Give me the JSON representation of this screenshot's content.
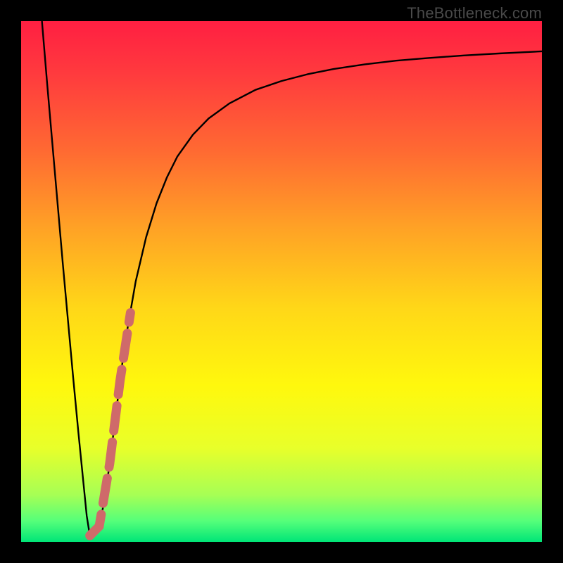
{
  "watermark": {
    "text": "TheBottleneck.com"
  },
  "chart_data": {
    "type": "line",
    "title": "",
    "xlabel": "",
    "ylabel": "",
    "xlim": [
      0,
      100
    ],
    "ylim": [
      0,
      100
    ],
    "grid": false,
    "legend": false,
    "gradient": {
      "stops": [
        {
          "offset": 0.0,
          "color": "#ff1f42"
        },
        {
          "offset": 0.1,
          "color": "#ff3a3e"
        },
        {
          "offset": 0.25,
          "color": "#ff6a32"
        },
        {
          "offset": 0.4,
          "color": "#ffa325"
        },
        {
          "offset": 0.55,
          "color": "#ffd718"
        },
        {
          "offset": 0.7,
          "color": "#fff80d"
        },
        {
          "offset": 0.82,
          "color": "#e8ff2a"
        },
        {
          "offset": 0.91,
          "color": "#a6ff55"
        },
        {
          "offset": 0.96,
          "color": "#55ff7a"
        },
        {
          "offset": 1.0,
          "color": "#00e577"
        }
      ]
    },
    "series": [
      {
        "name": "bottleneck-curve",
        "stroke": "#000000",
        "stroke_width": 2.4,
        "x": [
          4.0,
          5.0,
          6.0,
          7.0,
          8.0,
          9.0,
          10.0,
          11.0,
          12.0,
          12.6,
          13.2,
          14.0,
          15.0,
          16.0,
          17.0,
          18.0,
          19.0,
          20.0,
          22.0,
          24.0,
          26.0,
          28.0,
          30.0,
          33.0,
          36.0,
          40.0,
          45.0,
          50.0,
          55.0,
          60.0,
          66.0,
          72.0,
          78.0,
          85.0,
          92.0,
          100.0
        ],
        "y": [
          100.0,
          88.0,
          76.5,
          65.0,
          53.5,
          42.5,
          31.5,
          21.0,
          11.0,
          5.0,
          1.2,
          1.3,
          3.0,
          8.0,
          15.0,
          23.0,
          31.0,
          38.5,
          50.0,
          58.5,
          65.0,
          70.0,
          74.0,
          78.2,
          81.3,
          84.2,
          86.8,
          88.5,
          89.8,
          90.8,
          91.7,
          92.4,
          92.9,
          93.4,
          93.8,
          94.2
        ]
      },
      {
        "name": "highlight-segment",
        "stroke": "#cf6a6a",
        "stroke_width": 13,
        "linecap": "round",
        "dash": "36 16",
        "x": [
          13.2,
          15.0,
          17.0,
          19.0,
          21.0
        ],
        "y": [
          1.2,
          3.0,
          15.0,
          31.0,
          44.0
        ]
      }
    ]
  }
}
